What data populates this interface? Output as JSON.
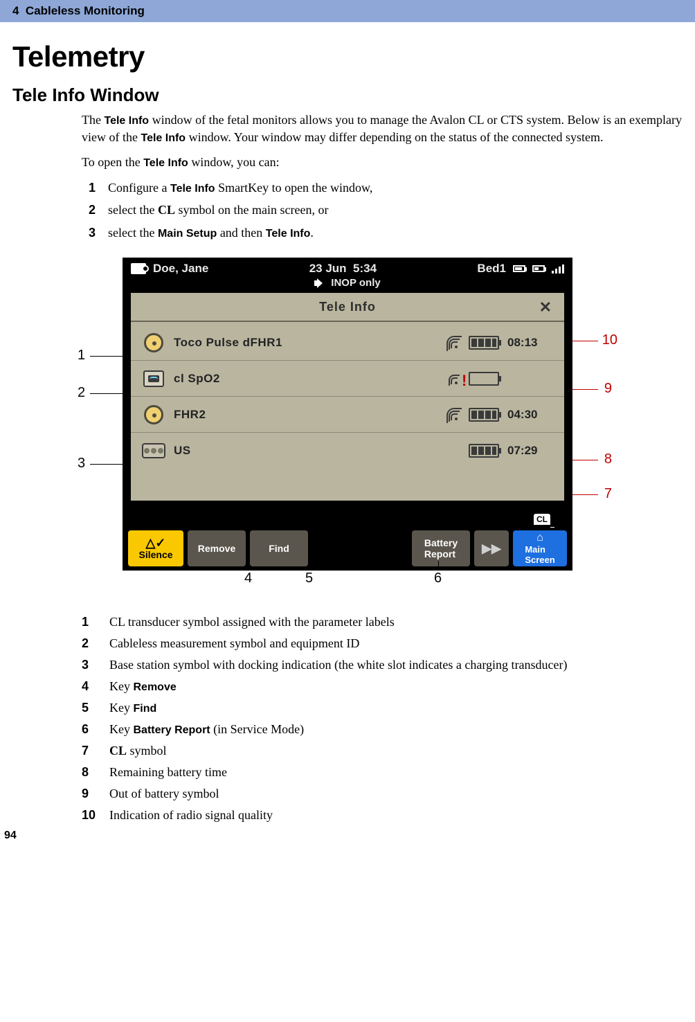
{
  "header": {
    "chapter": "4",
    "title": "Cableless Monitoring"
  },
  "page_number": "94",
  "h1": "Telemetry",
  "h2": "Tele Info Window",
  "intro": {
    "p1a": "The ",
    "p1b": " window of the fetal monitors allows you to manage the Avalon CL or CTS system. Below is an exemplary view of the ",
    "p1c": " window. Your window may differ depending on the status of the connected system.",
    "p2a": "To open the ",
    "p2b": " window, you can:",
    "term_teleinfo": "Tele Info"
  },
  "steps": {
    "s1a": "Configure a ",
    "s1b": " SmartKey to open the window,",
    "s2a": "select the ",
    "s2b": " symbol on the main screen, or",
    "cl": "CL",
    "s3a": "select the ",
    "s3b": " and then ",
    "s3c": ".",
    "term_main_setup": "Main Setup"
  },
  "monitor": {
    "patient": "Doe, Jane",
    "date": "23  Jun",
    "time": "5:34",
    "bed": "Bed1",
    "inop": "INOP  only",
    "panel_title": "Tele  Info",
    "close": "✕",
    "rows": [
      {
        "label": "Toco Pulse dFHR1",
        "time": "08:13",
        "signal": true,
        "battery": "full",
        "icon": "round"
      },
      {
        "label": "cl SpO2",
        "time": "",
        "signal": true,
        "battery": "low",
        "icon": "box"
      },
      {
        "label": "FHR2",
        "time": "04:30",
        "signal": true,
        "battery": "full",
        "icon": "round"
      },
      {
        "label": "US",
        "time": "07:29",
        "signal": false,
        "battery": "full",
        "icon": "long"
      }
    ],
    "cl_tag": "CL",
    "softkeys": {
      "silence": "Silence",
      "remove": "Remove",
      "find": "Find",
      "battery_report": "Battery\nReport",
      "main_screen": "Main\nScreen"
    }
  },
  "callouts": {
    "c1": "1",
    "c2": "2",
    "c3": "3",
    "c4": "4",
    "c5": "5",
    "c6": "6",
    "c7": "7",
    "c8": "8",
    "c9": "9",
    "c10": "10"
  },
  "legend": {
    "l1": "CL transducer symbol assigned with the parameter labels",
    "l2": "Cableless measurement symbol and equipment ID",
    "l3": "Base station symbol with docking indication (the white slot indicates a charging transducer)",
    "l4a": "Key ",
    "l4b": "Remove",
    "l5a": "Key ",
    "l5b": "Find",
    "l6a": "Key ",
    "l6b": "Battery Report",
    "l6c": " (in Service Mode)",
    "l7a": "CL",
    "l7b": " symbol",
    "l8": "Remaining battery time",
    "l9": "Out of battery symbol",
    "l10": "Indication of radio signal quality"
  }
}
